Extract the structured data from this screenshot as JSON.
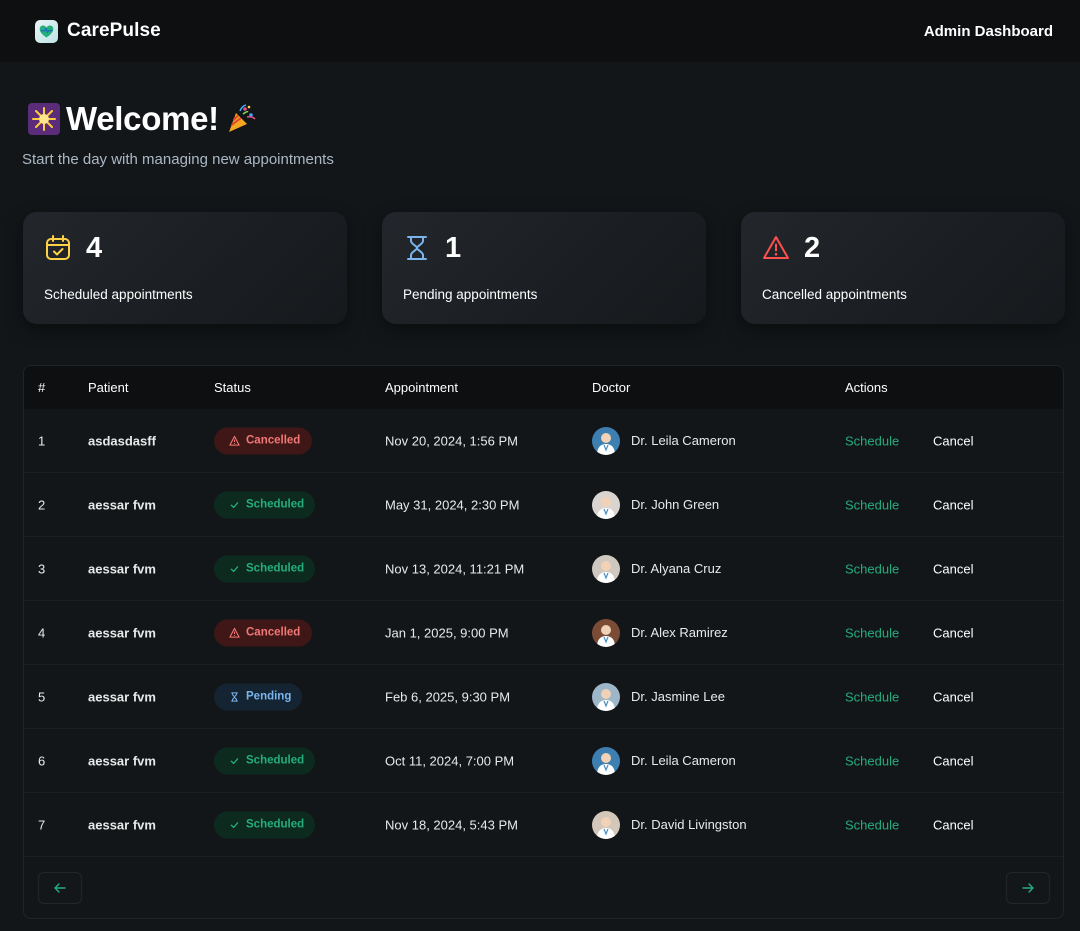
{
  "header": {
    "brand": "CarePulse",
    "admin_label": "Admin Dashboard"
  },
  "welcome": {
    "title": "Welcome!",
    "subtitle": "Start the day with managing new appointments",
    "emoji_left": "sparkle-icon",
    "emoji_right": "party-popper-icon"
  },
  "stats": [
    {
      "count": "4",
      "label": "Scheduled appointments",
      "icon": "calendar-check-icon",
      "color": "#FFD147"
    },
    {
      "count": "1",
      "label": "Pending appointments",
      "icon": "hourglass-icon",
      "color": "#79B5EC"
    },
    {
      "count": "2",
      "label": "Cancelled appointments",
      "icon": "alert-triangle-icon",
      "color": "#FF4F4E"
    }
  ],
  "table": {
    "headers": [
      "#",
      "Patient",
      "Status",
      "Appointment",
      "Doctor",
      "Actions"
    ],
    "rows": [
      {
        "idx": "1",
        "patient": "asdasdasff",
        "status": "Cancelled",
        "status_type": "cancelled",
        "appointment": "Nov 20, 2024, 1:56 PM",
        "doctor": "Dr. Leila Cameron",
        "schedule": "Schedule",
        "cancel": "Cancel"
      },
      {
        "idx": "2",
        "patient": "aessar fvm",
        "status": "Scheduled",
        "status_type": "scheduled",
        "appointment": "May 31, 2024, 2:30 PM",
        "doctor": "Dr. John Green",
        "schedule": "Schedule",
        "cancel": "Cancel"
      },
      {
        "idx": "3",
        "patient": "aessar fvm",
        "status": "Scheduled",
        "status_type": "scheduled",
        "appointment": "Nov 13, 2024, 11:21 PM",
        "doctor": "Dr. Alyana Cruz",
        "schedule": "Schedule",
        "cancel": "Cancel"
      },
      {
        "idx": "4",
        "patient": "aessar fvm",
        "status": "Cancelled",
        "status_type": "cancelled",
        "appointment": "Jan 1, 2025, 9:00 PM",
        "doctor": "Dr. Alex Ramirez",
        "schedule": "Schedule",
        "cancel": "Cancel"
      },
      {
        "idx": "5",
        "patient": "aessar fvm",
        "status": "Pending",
        "status_type": "pending",
        "appointment": "Feb 6, 2025, 9:30 PM",
        "doctor": "Dr. Jasmine Lee",
        "schedule": "Schedule",
        "cancel": "Cancel"
      },
      {
        "idx": "6",
        "patient": "aessar fvm",
        "status": "Scheduled",
        "status_type": "scheduled",
        "appointment": "Oct 11, 2024, 7:00 PM",
        "doctor": "Dr. Leila Cameron",
        "schedule": "Schedule",
        "cancel": "Cancel"
      },
      {
        "idx": "7",
        "patient": "aessar fvm",
        "status": "Scheduled",
        "status_type": "scheduled",
        "appointment": "Nov 18, 2024, 5:43 PM",
        "doctor": "Dr. David Livingston",
        "schedule": "Schedule",
        "cancel": "Cancel"
      }
    ]
  },
  "pagination": {
    "prev_icon": "arrow-left-icon",
    "next_icon": "arrow-right-icon"
  },
  "colors": {
    "accent_green": "#24AE7C",
    "danger_red": "#F37877",
    "pending_blue": "#79B5EC",
    "background": "#131619"
  }
}
